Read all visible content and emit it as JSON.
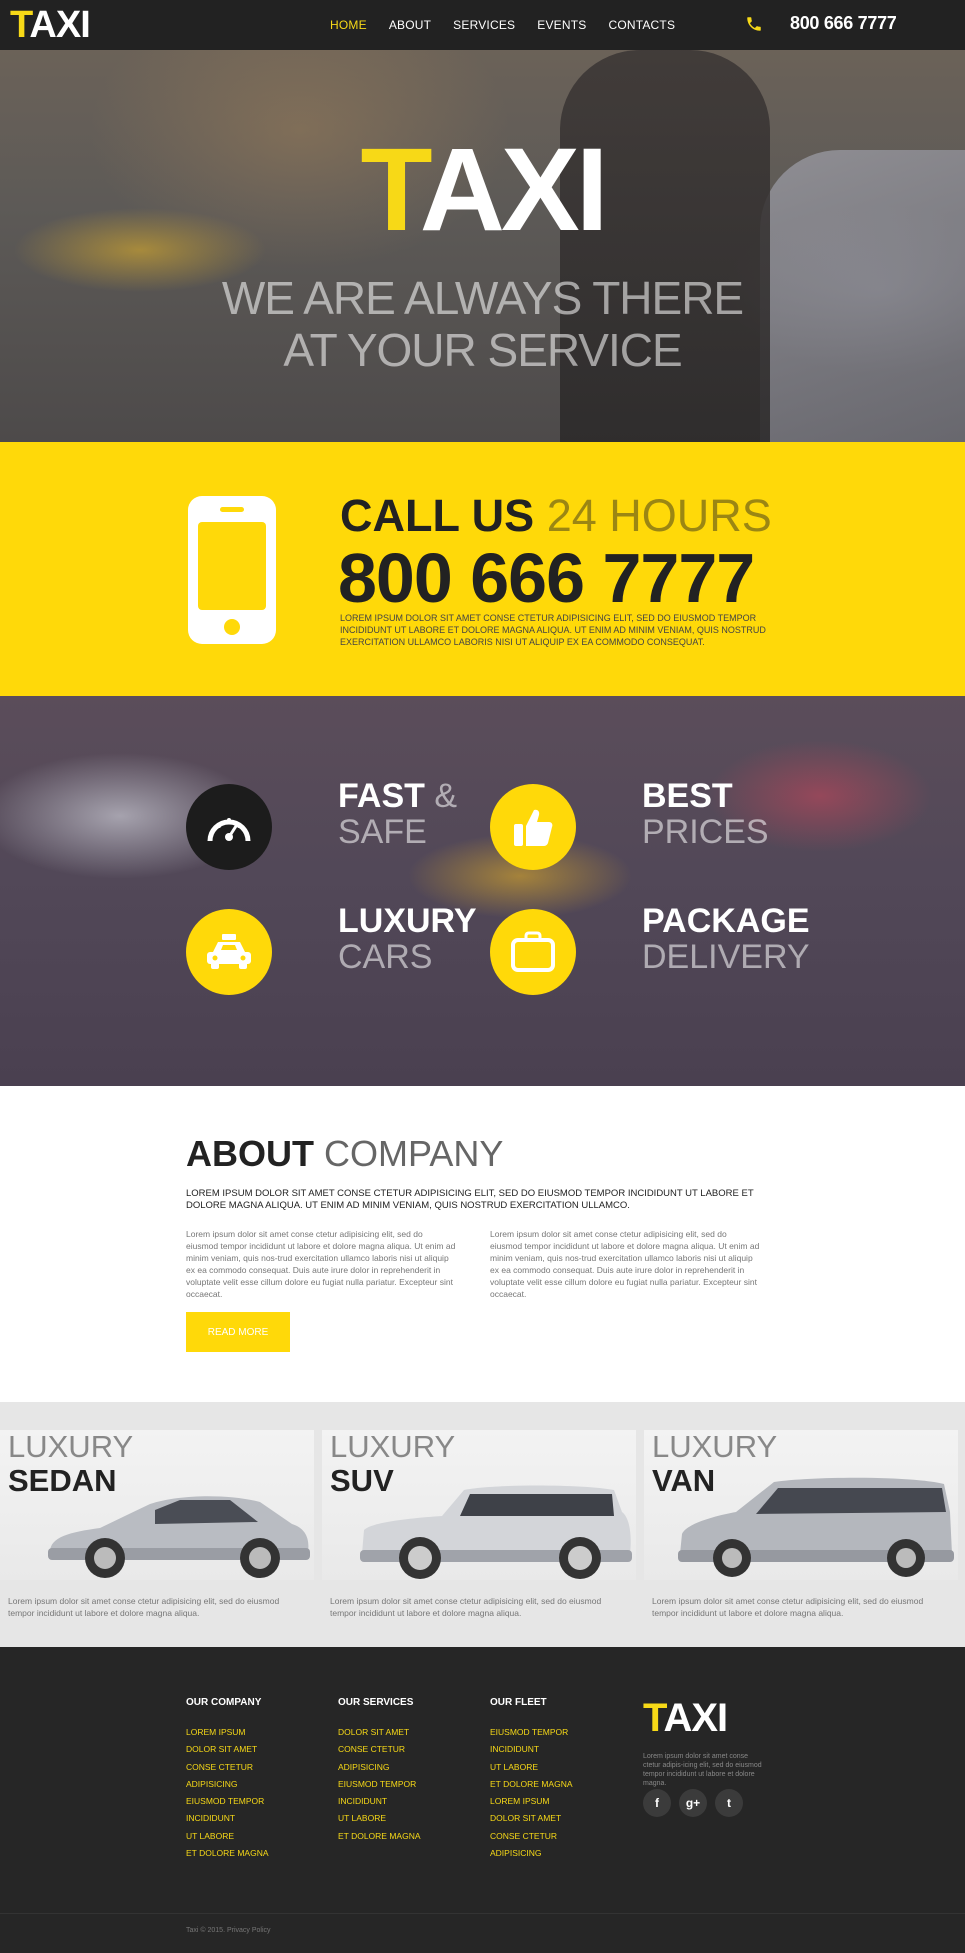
{
  "header": {
    "logo_first": "T",
    "logo_rest": "AXI",
    "nav": [
      {
        "label": "HOME",
        "active": true
      },
      {
        "label": "ABOUT",
        "active": false
      },
      {
        "label": "SERVICES",
        "active": false
      },
      {
        "label": "EVENTS",
        "active": false
      },
      {
        "label": "CONTACTS",
        "active": false
      }
    ],
    "phone": "800 666 7777"
  },
  "hero": {
    "title_first": "T",
    "title_rest": "AXI",
    "subtitle_line1": "WE ARE ALWAYS THERE",
    "subtitle_line2": "AT YOUR SERVICE"
  },
  "callband": {
    "title_bold": "CALL US",
    "title_light": "24 HOURS",
    "number": "800 666 7777",
    "text": "LOREM IPSUM DOLOR SIT AMET CONSE CTETUR ADIPISICING ELIT, SED DO EIUSMOD TEMPOR INCIDIDUNT UT LABORE ET DOLORE MAGNA ALIQUA. UT ENIM AD MINIM VENIAM, QUIS NOSTRUD EXERCITATION ULLAMCO LABORIS NISI UT ALIQUIP EX EA COMMODO CONSEQUAT."
  },
  "features": [
    {
      "title": "FAST",
      "amp": "&",
      "sub": "SAFE",
      "icon": "speedometer-icon"
    },
    {
      "title": "BEST",
      "amp": "",
      "sub": "PRICES",
      "icon": "thumbs-up-icon"
    },
    {
      "title": "LUXURY",
      "amp": "",
      "sub": "CARS",
      "icon": "taxi-icon"
    },
    {
      "title": "PACKAGE",
      "amp": "",
      "sub": "DELIVERY",
      "icon": "suitcase-icon"
    }
  ],
  "about": {
    "title_bold": "ABOUT",
    "title_light": "COMPANY",
    "lead": "LOREM IPSUM DOLOR SIT AMET CONSE CTETUR ADIPISICING ELIT, SED DO EIUSMOD TEMPOR INCIDIDUNT UT LABORE ET DOLORE MAGNA ALIQUA. UT ENIM AD MINIM VENIAM, QUIS NOSTRUD EXERCITATION ULLAMCO.",
    "col1": "Lorem ipsum dolor sit amet conse ctetur adipisicing elit, sed do eiusmod tempor incididunt ut labore et dolore magna aliqua. Ut enim ad minim veniam, quis nos-trud exercitation ullamco laboris nisi ut aliquip ex ea commodo consequat. Duis aute irure dolor in reprehenderit in voluptate velit esse cillum dolore eu fugiat nulla pariatur. Excepteur sint occaecat.",
    "col2": "Lorem ipsum dolor sit amet conse ctetur adipisicing elit, sed do eiusmod tempor incididunt ut labore et dolore magna aliqua. Ut enim ad minim veniam, quis nos-trud exercitation ullamco laboris nisi ut aliquip ex ea commodo consequat. Duis aute irure dolor in reprehenderit in voluptate velit esse cillum dolore eu fugiat nulla pariatur. Excepteur sint occaecat.",
    "button": "READ MORE"
  },
  "fleet": [
    {
      "lux": "LUXURY",
      "type": "SEDAN",
      "text": "Lorem ipsum dolor sit amet conse ctetur adipisicing elit, sed do eiusmod tempor incididunt ut labore et dolore magna aliqua."
    },
    {
      "lux": "LUXURY",
      "type": "SUV",
      "text": "Lorem ipsum dolor sit amet conse ctetur adipisicing elit, sed do eiusmod tempor incididunt ut labore et dolore magna aliqua."
    },
    {
      "lux": "LUXURY",
      "type": "VAN",
      "text": "Lorem ipsum dolor sit amet conse ctetur adipisicing elit, sed do eiusmod tempor incididunt ut labore et dolore magna aliqua."
    }
  ],
  "footer": {
    "columns": [
      {
        "title": "OUR COMPANY",
        "items": [
          "LOREM IPSUM",
          "DOLOR SIT AMET",
          "CONSE CTETUR",
          "ADIPISICING",
          "EIUSMOD TEMPOR",
          "INCIDIDUNT",
          "UT LABORE",
          "ET DOLORE MAGNA"
        ]
      },
      {
        "title": "OUR SERVICES",
        "items": [
          "DOLOR SIT AMET",
          "CONSE CTETUR",
          "ADIPISICING",
          "EIUSMOD TEMPOR",
          "INCIDIDUNT",
          "UT LABORE",
          "ET DOLORE MAGNA"
        ]
      },
      {
        "title": "OUR FLEET",
        "items": [
          "EIUSMOD TEMPOR",
          "INCIDIDUNT",
          "UT LABORE",
          "ET DOLORE MAGNA",
          "LOREM IPSUM",
          "DOLOR SIT AMET",
          "CONSE CTETUR",
          "ADIPISICING"
        ]
      }
    ],
    "logo_first": "T",
    "logo_rest": "AXI",
    "text": "Lorem ipsum dolor sit amet conse ctetur adipis-icing elit, sed do eiusmod tempor incididunt ut labore et dolore magna.",
    "social": [
      {
        "icon": "facebook-icon",
        "glyph": "f"
      },
      {
        "icon": "google-plus-icon",
        "glyph": "g+"
      },
      {
        "icon": "twitter-icon",
        "glyph": "t"
      }
    ],
    "copyright": "Taxi © 2015. Privacy Policy"
  },
  "colors": {
    "accent": "#ffd909",
    "dark": "#222222",
    "footer": "#262626"
  }
}
